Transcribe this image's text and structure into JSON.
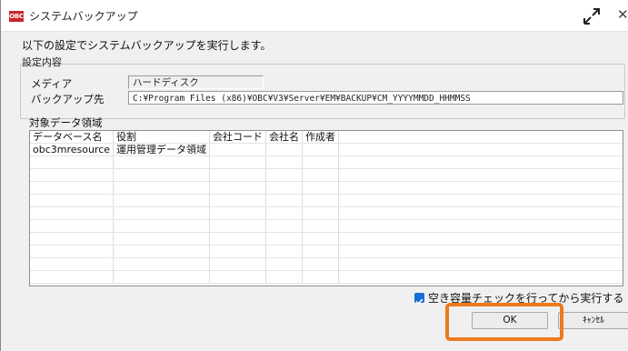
{
  "window": {
    "icon_text": "OBC",
    "title": "システムバックアップ"
  },
  "message": "以下の設定でシステムバックアップを実行します。",
  "settings": {
    "group_label": "設定内容",
    "media_label": "メディア",
    "media_value": "ハードディスク",
    "backup_label": "バックアップ先",
    "backup_path": "C:¥Program Files (x86)¥OBC¥V3¥Server¥EM¥BACKUP¥CM_YYYYMMDD_HHMMSS"
  },
  "target": {
    "label": "対象データ領域",
    "columns": [
      "データベース名",
      "役割",
      "会社コード",
      "会社名",
      "作成者"
    ],
    "rows": [
      [
        "obc3mresource",
        "運用管理データ領域",
        "",
        "",
        ""
      ]
    ]
  },
  "check_option": {
    "checked": true,
    "label": "空き容量チェックを行ってから実行する"
  },
  "buttons": {
    "ok": "OK",
    "cancel": "ｷｬﾝｾﾙ"
  },
  "colors": {
    "highlight": "#ec7a1e",
    "checkbox": "#1a6fd8",
    "app_icon": "#c8262d"
  }
}
